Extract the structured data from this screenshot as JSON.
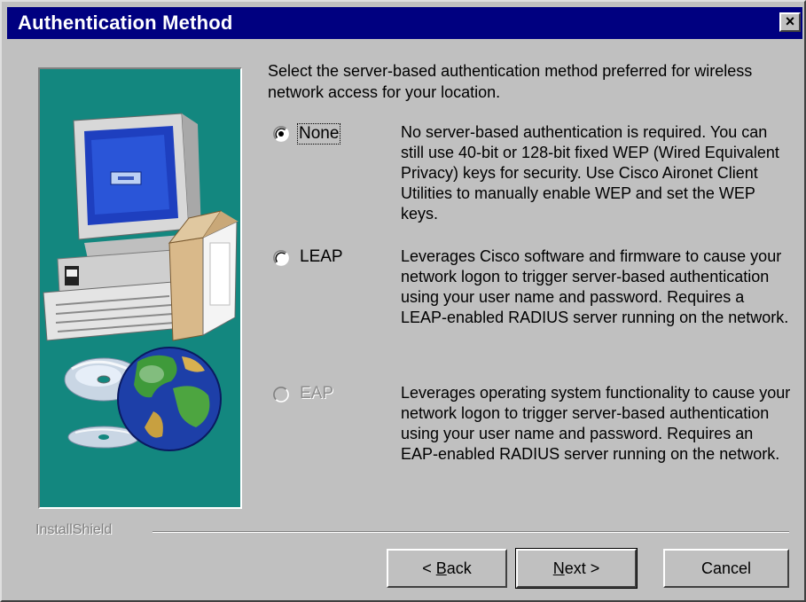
{
  "window": {
    "title": "Authentication Method",
    "close_glyph": "×"
  },
  "intro_text": "Select the server-based authentication method preferred for wireless network access for your location.",
  "options": [
    {
      "label": "None",
      "selected": true,
      "enabled": true,
      "description": "No server-based authentication is required. You can still use 40-bit or 128-bit fixed WEP (Wired Equivalent Privacy) keys for security. Use Cisco Aironet Client Utilities to manually enable WEP and set the WEP keys."
    },
    {
      "label": "LEAP",
      "selected": false,
      "enabled": true,
      "description": "Leverages Cisco software and firmware to cause your network logon to trigger server-based authentication using your user name and password.  Requires a LEAP-enabled RADIUS server running on the network."
    },
    {
      "label": "EAP",
      "selected": false,
      "enabled": false,
      "description": "Leverages operating system functionality to cause your network logon to trigger server-based authentication using your user name and password.  Requires an EAP-enabled RADIUS server running on the network."
    }
  ],
  "brand": "InstallShield",
  "buttons": {
    "back": {
      "prefix": "< ",
      "mnemonic": "B",
      "rest": "ack"
    },
    "next": {
      "mnemonic": "N",
      "rest": "ext >"
    },
    "cancel": "Cancel"
  },
  "colors": {
    "titlebar": "#000080",
    "dialog_bg": "#c0c0c0",
    "illustration_bg": "#13877f"
  },
  "icons": [
    "close-icon",
    "computer-illustration",
    "cd-discs-illustration",
    "globe-illustration"
  ]
}
